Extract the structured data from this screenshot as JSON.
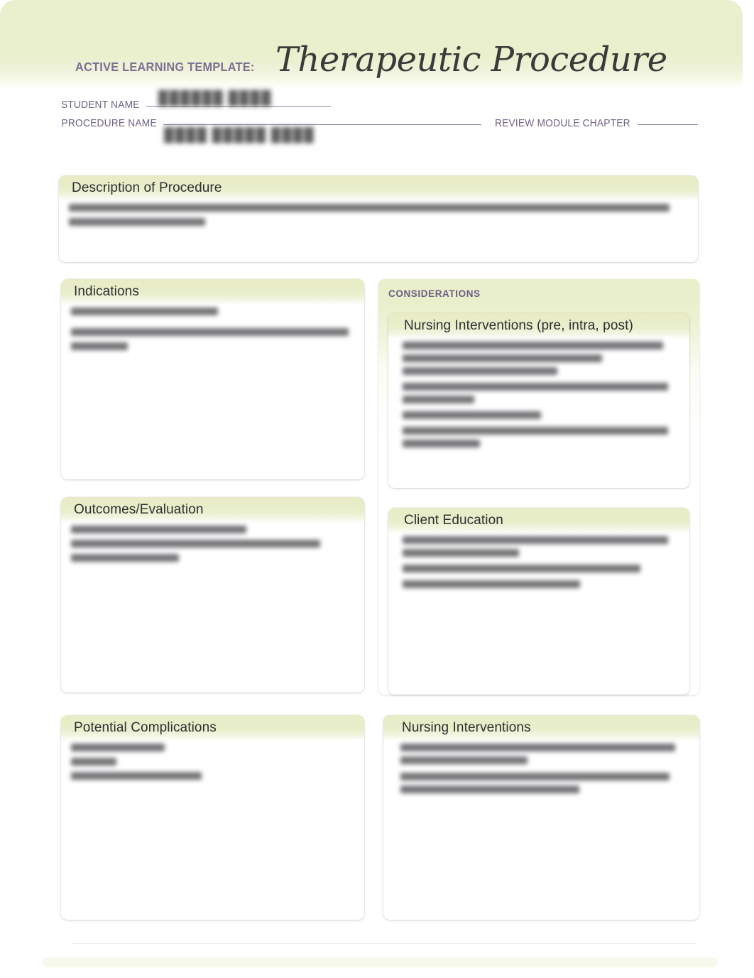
{
  "header": {
    "alt_label": "ACTIVE LEARNING TEMPLATE:",
    "title": "Therapeutic Procedure",
    "banner_color": "#eaefcd",
    "label_color": "#7d7092"
  },
  "form": {
    "student_name_label": "STUDENT NAME",
    "student_name_value": "",
    "procedure_name_label": "PROCEDURE NAME",
    "procedure_name_value": "",
    "review_module_chapter_label": "REVIEW MODULE CHAPTER",
    "review_module_chapter_value": ""
  },
  "sections": {
    "description": {
      "title": "Description of Procedure",
      "content": ""
    },
    "indications": {
      "title": "Indications",
      "content": ""
    },
    "outcomes": {
      "title": "Outcomes/Evaluation",
      "content": ""
    },
    "potential_complications": {
      "title": "Potential Complications",
      "content": ""
    },
    "considerations": {
      "label": "CONSIDERATIONS",
      "accent_color": "#6b5f85",
      "nursing_interventions_phases": {
        "title": "Nursing Interventions (pre, intra, post)",
        "content": ""
      },
      "client_education": {
        "title": "Client Education",
        "content": ""
      }
    },
    "nursing_interventions": {
      "title": "Nursing Interventions",
      "content": ""
    }
  },
  "theme": {
    "band_green": "#e7ecc6",
    "page_background": "#ffffff",
    "text_color": "#2e2e33"
  }
}
